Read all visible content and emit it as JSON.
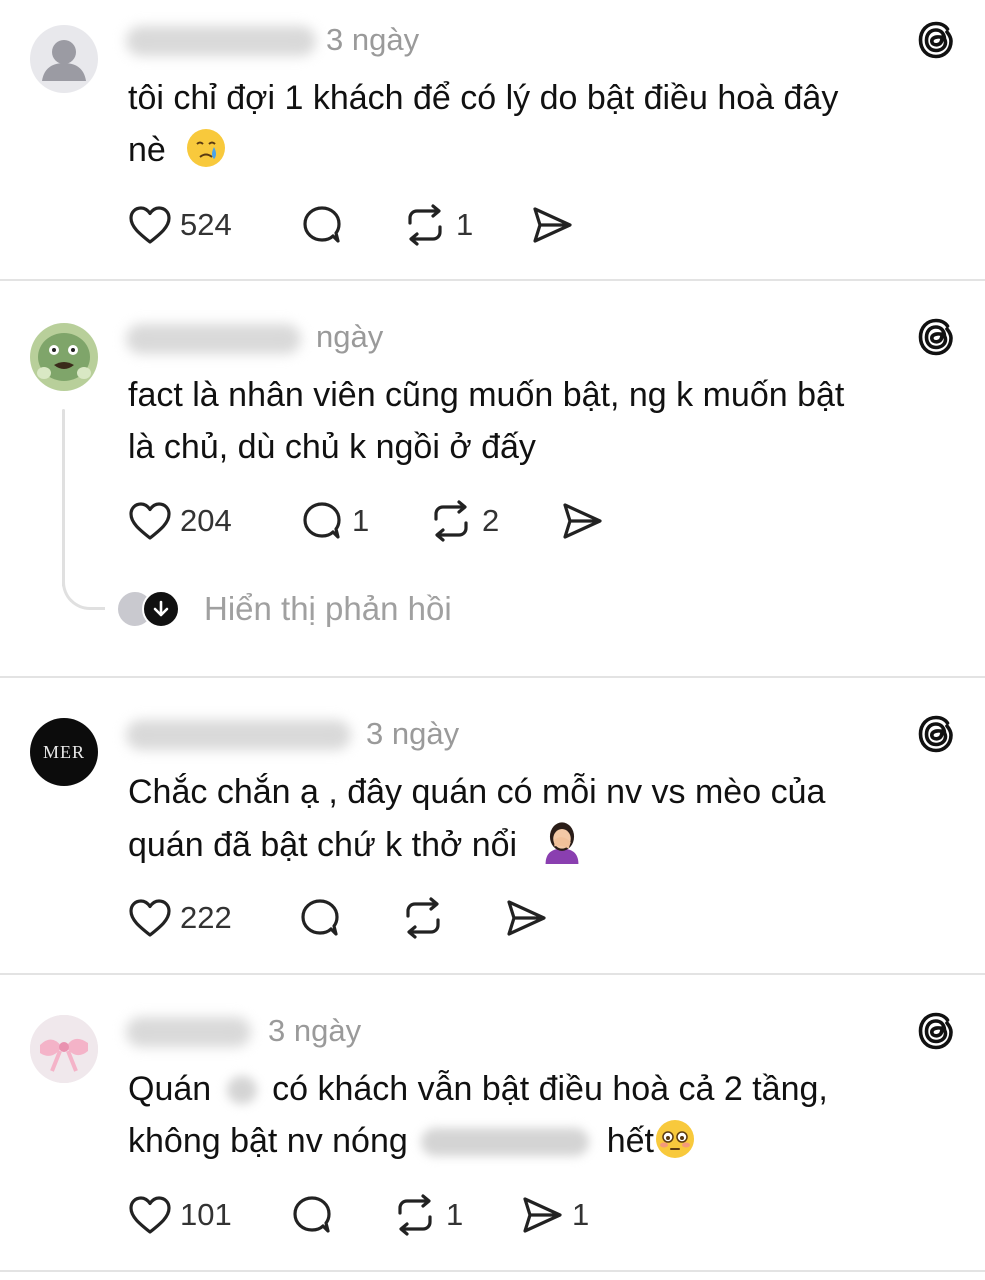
{
  "posts": [
    {
      "time": "3 ngày",
      "text_lines": [
        "tôi chỉ đợi 1 khách để có lý do bật điều hoà đây",
        "nè"
      ],
      "emoji": "crying-face",
      "likes": "524",
      "replies": "",
      "reposts": "1",
      "shares": ""
    },
    {
      "time": "ngày",
      "text_lines": [
        "fact là nhân viên cũng muốn bật, ng k muốn bật",
        "là chủ, dù chủ k ngồi ở đấy"
      ],
      "likes": "204",
      "replies": "1",
      "reposts": "2",
      "shares": "",
      "show_replies_label": "Hiển thị phản hồi"
    },
    {
      "time": "3 ngày",
      "text_lines": [
        "Chắc chắn ạ , đây quán có mỗi nv vs mèo của",
        "quán đã bật chứ k thở nổi"
      ],
      "emoji": "person-facepalming",
      "avatar_text": "MER",
      "likes": "222",
      "replies": "",
      "reposts": "",
      "shares": ""
    },
    {
      "time": "3 ngày",
      "text_line1_a": "Quán",
      "text_line1_b": "có khách vẫn bật điều hoà cả 2 tầng,",
      "text_line2_a": "không bật nv nóng",
      "text_line2_b": "hết",
      "emoji": "flushed-face",
      "likes": "101",
      "replies": "",
      "reposts": "1",
      "shares": "1"
    }
  ],
  "colors": {
    "divider": "#e3e3e3",
    "muted_text": "#9a9a9a",
    "text": "#111111"
  }
}
